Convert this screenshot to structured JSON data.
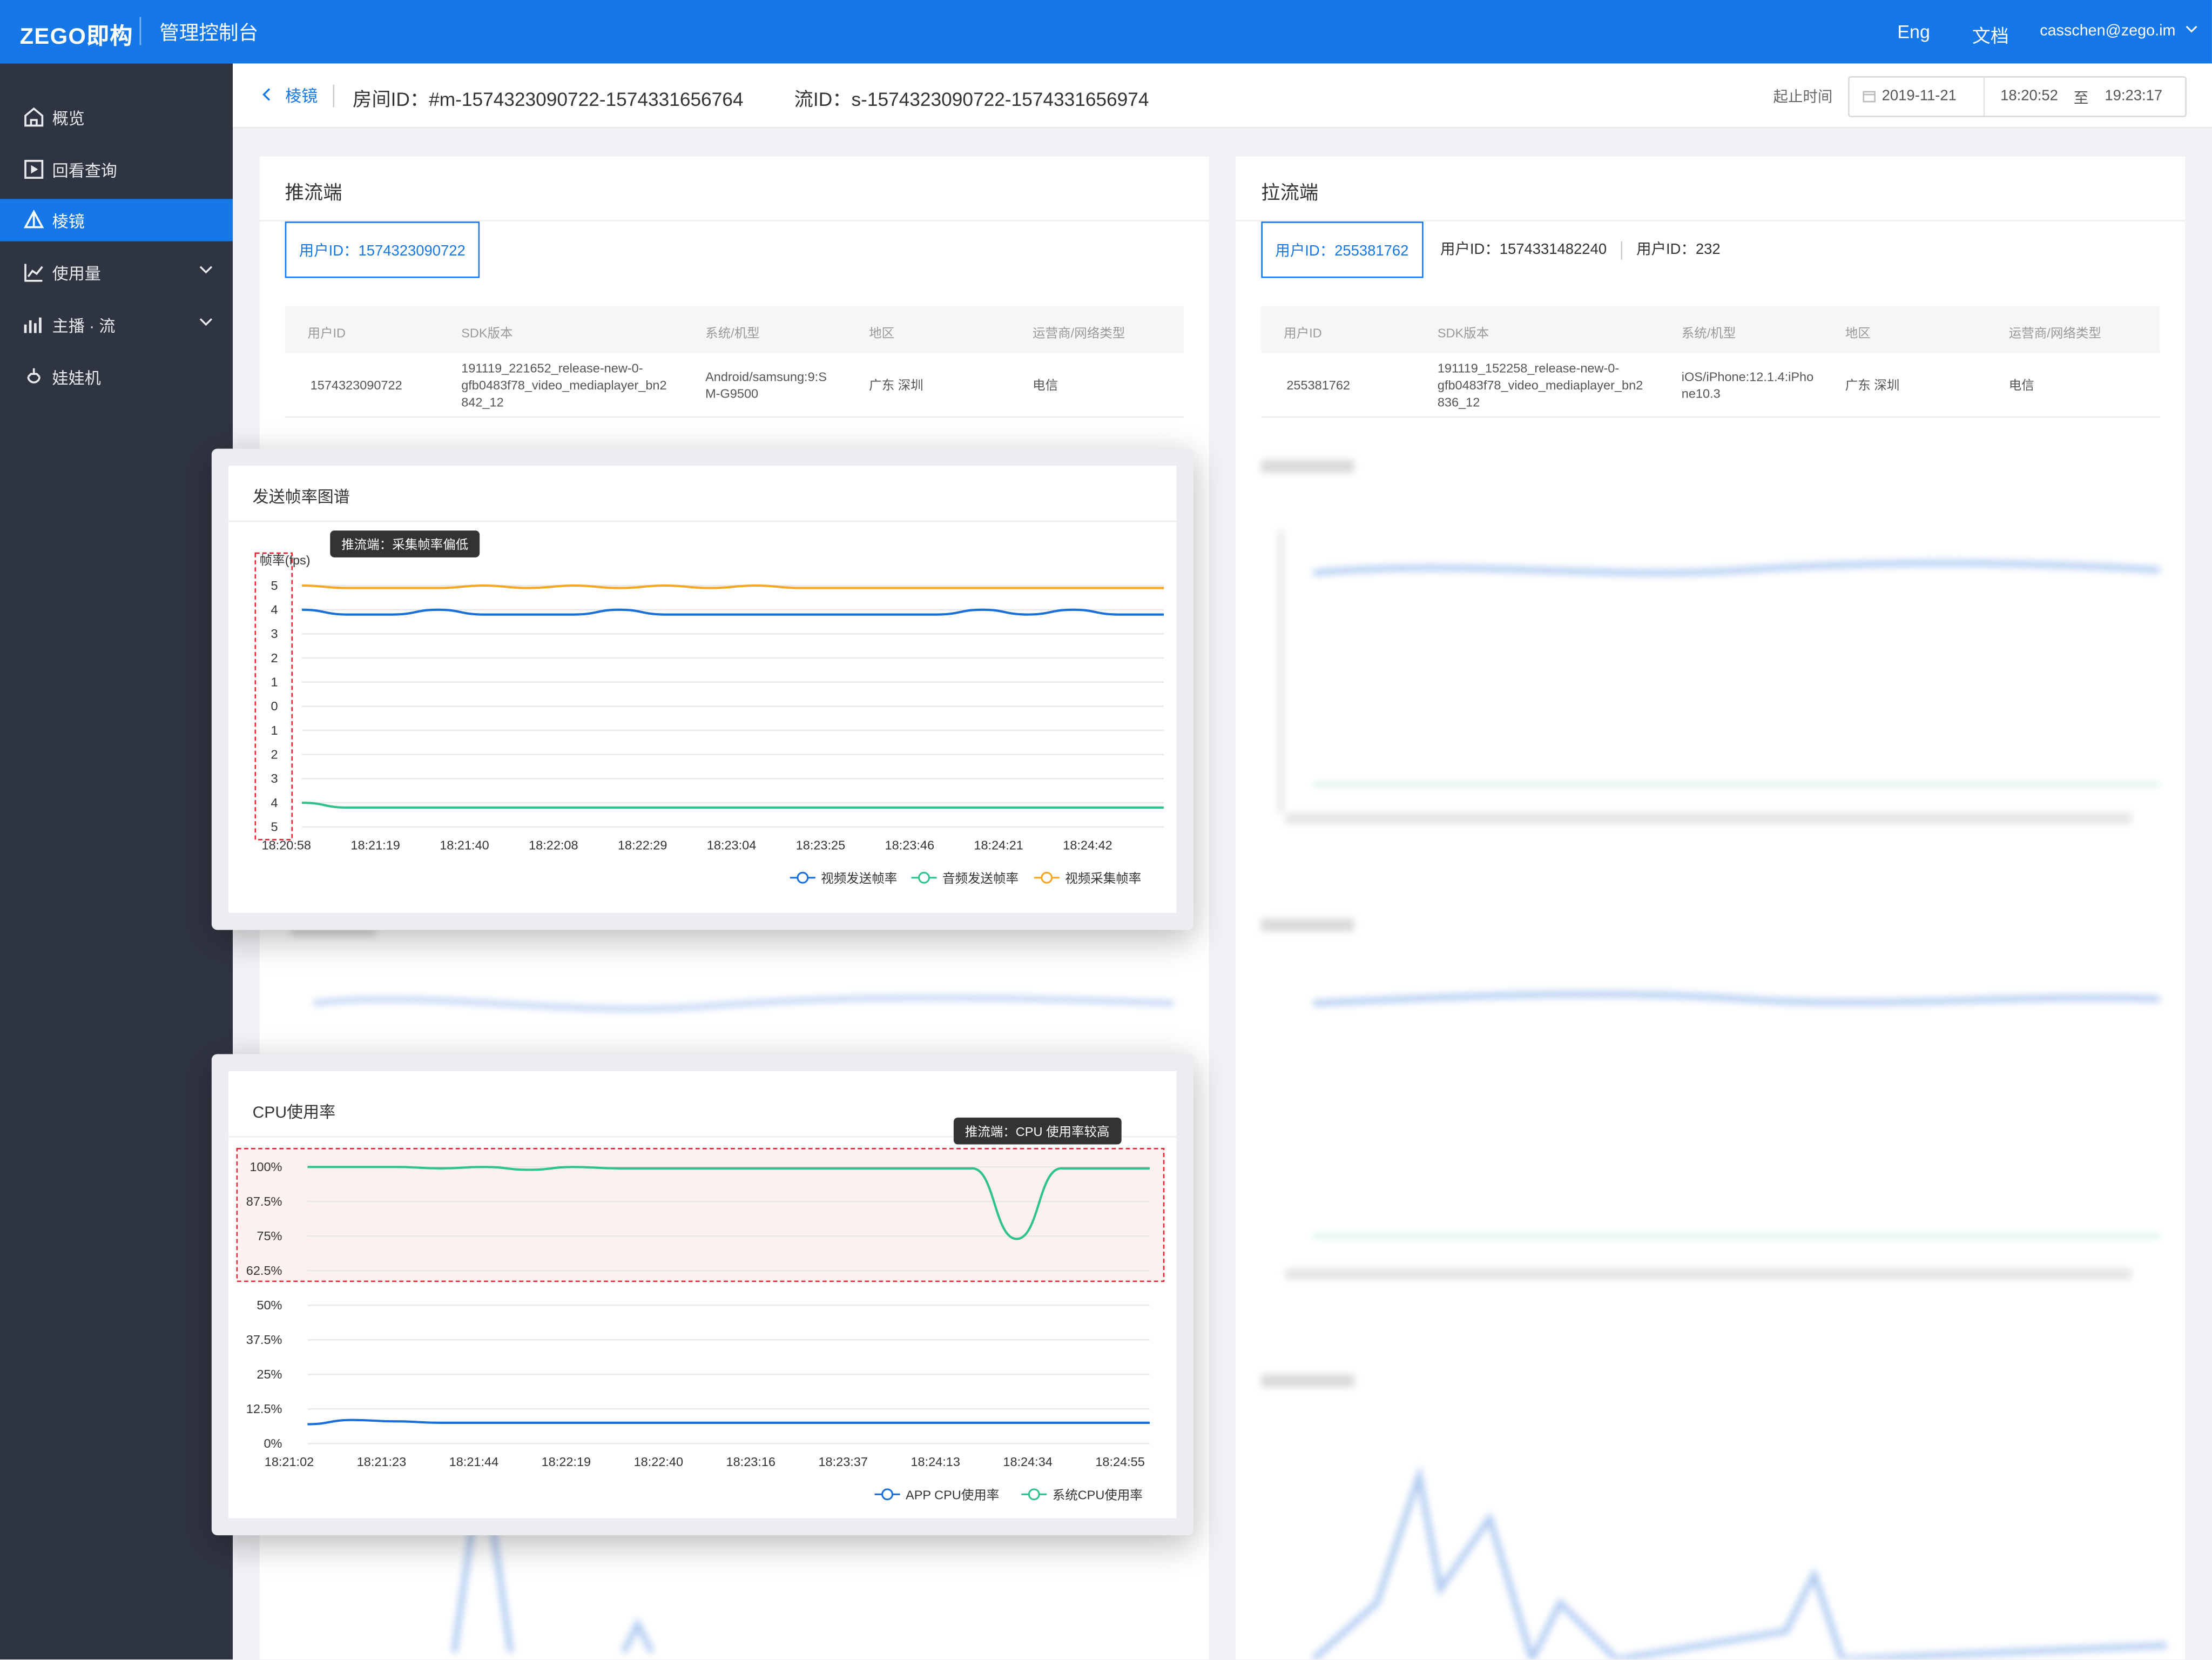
{
  "topbar": {
    "logo": "ZEGO即构",
    "title": "管理控制台",
    "lang": "Eng",
    "docs": "文档",
    "user": "casschen@zego.im"
  },
  "sidebar": {
    "items": [
      {
        "label": "概览",
        "icon": "home-icon"
      },
      {
        "label": "回看查询",
        "icon": "playback-icon"
      },
      {
        "label": "棱镜",
        "icon": "prism-icon",
        "active": true
      },
      {
        "label": "使用量",
        "icon": "usage-chart-icon"
      },
      {
        "label": "主播 · 流",
        "icon": "bar-chart-icon"
      },
      {
        "label": "娃娃机",
        "icon": "claw-machine-icon"
      }
    ]
  },
  "header": {
    "back_label": "棱镜",
    "room_id": "房间ID：#m-1574323090722-1574331656764",
    "stream_id": "流ID：s-1574323090722-1574331656974",
    "time_label": "起止时间",
    "date": "2019-11-21",
    "time_start": "18:20:52",
    "to": "至",
    "time_end": "19:23:17"
  },
  "push": {
    "title": "推流端",
    "user_tab": "用户ID：1574323090722",
    "columns": [
      "用户ID",
      "SDK版本",
      "系统/机型",
      "地区",
      "运营商/网络类型"
    ],
    "row": {
      "user_id": "1574323090722",
      "sdk": [
        "191119_221652_release-new-0-",
        "gfb0483f78_video_mediaplayer_bn2",
        "842_12"
      ],
      "system": [
        "Android/samsung:9:S",
        "M-G9500"
      ],
      "region": "广东 深圳",
      "carrier": "电信"
    }
  },
  "pull": {
    "title": "拉流端",
    "user_tabs": [
      "用户ID：255381762",
      "用户ID：1574331482240",
      "用户ID：232"
    ],
    "columns": [
      "用户ID",
      "SDK版本",
      "系统/机型",
      "地区",
      "运营商/网络类型"
    ],
    "row": {
      "user_id": "255381762",
      "sdk": [
        "191119_152258_release-new-0-",
        "gfb0483f78_video_mediaplayer_bn2",
        "836_12"
      ],
      "system": [
        "iOS/iPhone:12.1.4:iPho",
        "ne10.3"
      ],
      "region": "广东 深圳",
      "carrier": "电信"
    }
  },
  "fps_card": {
    "title": "发送帧率图谱",
    "tooltip": "推流端：采集帧率偏低",
    "chart_data": {
      "type": "line",
      "ylabel": "帧率(fps)",
      "y_ticks": [
        "5",
        "4",
        "3",
        "2",
        "1",
        "0",
        "1",
        "2",
        "3",
        "4",
        "5"
      ],
      "x": [
        "18:20:58",
        "18:21:19",
        "18:21:40",
        "18:22:08",
        "18:22:29",
        "18:23:04",
        "18:23:25",
        "18:23:46",
        "18:24:21",
        "18:24:42"
      ],
      "series": [
        {
          "name": "视频发送帧率",
          "color": "#1a6fd8",
          "values": [
            4.0,
            3.8,
            3.8,
            4.0,
            3.8,
            3.8,
            3.8,
            4.0,
            3.8,
            3.8,
            3.8,
            3.8,
            3.8,
            3.8,
            3.8,
            4.0,
            3.8,
            4.0,
            3.8,
            3.8
          ]
        },
        {
          "name": "音频发送帧率",
          "color": "#2fc28b",
          "values": [
            -4.0,
            -4.2,
            -4.2,
            -4.2,
            -4.2,
            -4.2,
            -4.2,
            -4.2,
            -4.2,
            -4.2,
            -4.2,
            -4.2,
            -4.2,
            -4.2,
            -4.2,
            -4.2,
            -4.2,
            -4.2,
            -4.2,
            -4.2
          ]
        },
        {
          "name": "视频采集帧率",
          "color": "#f5a623",
          "values": [
            5.0,
            4.9,
            4.9,
            4.9,
            5.0,
            4.9,
            5.0,
            4.9,
            5.0,
            4.9,
            5.0,
            4.9,
            4.9,
            4.9,
            4.9,
            4.9,
            4.9,
            4.9,
            4.9,
            4.9
          ]
        }
      ]
    }
  },
  "cpu_card": {
    "title": "CPU使用率",
    "tooltip": "推流端：CPU 使用率较高",
    "chart_data": {
      "type": "line",
      "y_ticks": [
        "100%",
        "87.5%",
        "75%",
        "62.5%",
        "50%",
        "37.5%",
        "25%",
        "12.5%",
        "0%"
      ],
      "x": [
        "18:21:02",
        "18:21:23",
        "18:21:44",
        "18:22:19",
        "18:22:40",
        "18:23:16",
        "18:23:37",
        "18:24:13",
        "18:24:34",
        "18:24:55"
      ],
      "series": [
        {
          "name": "APP CPU使用率",
          "color": "#1a6fd8",
          "values": [
            7,
            8.5,
            8,
            7.5,
            7.5,
            7.5,
            7.5,
            7.5,
            7.5,
            7.5,
            7.5,
            7.5,
            7.5,
            7.5,
            7.5,
            7.5,
            7.5,
            7.5,
            7.5,
            7.5
          ]
        },
        {
          "name": "系统CPU使用率",
          "color": "#2fc28b",
          "values": [
            100,
            100,
            100,
            99.5,
            100,
            99,
            100,
            99.5,
            99.5,
            99.5,
            99.5,
            99.5,
            99.5,
            99.5,
            99.5,
            99.5,
            74,
            99.5,
            99.5,
            99.5
          ]
        }
      ]
    }
  }
}
